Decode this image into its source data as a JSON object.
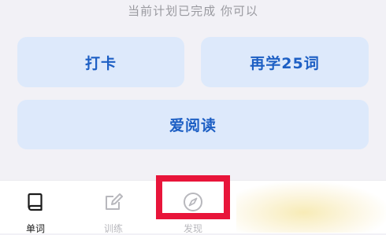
{
  "status_text": "当前计划已完成 你可以",
  "actions": {
    "checkin_label": "打卡",
    "learn_more_label": "再学25词",
    "read_label": "爱阅读"
  },
  "tabbar": {
    "tabs": [
      {
        "label": "单词",
        "icon": "book-icon",
        "active": true
      },
      {
        "label": "训练",
        "icon": "edit-icon",
        "active": false
      },
      {
        "label": "发现",
        "icon": "compass-icon",
        "active": false
      }
    ]
  },
  "colors": {
    "accent": "#1d5fc4",
    "button_bg": "#dde9fb",
    "highlight": "#e8153a",
    "background": "#f2f1f6"
  }
}
